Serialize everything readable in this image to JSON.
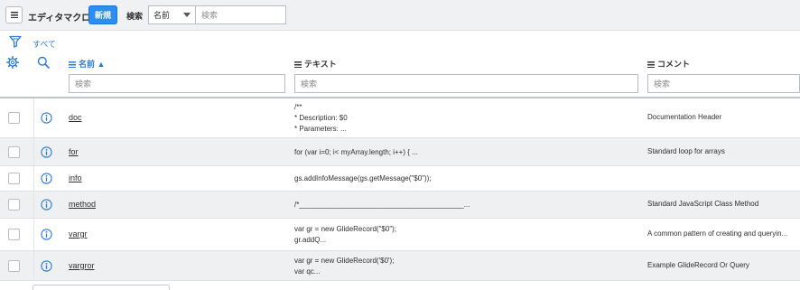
{
  "header": {
    "title": "エディタマクロ",
    "new_label": "新規",
    "search_label": "検索",
    "search_field": "名前",
    "search_placeholder": "検索"
  },
  "filter": {
    "label": "すべて"
  },
  "columns": [
    {
      "label": "名前 ▲",
      "sorted": true
    },
    {
      "label": "テキスト",
      "sorted": false
    },
    {
      "label": "コメント",
      "sorted": false
    }
  ],
  "column_filter_placeholder": "検索",
  "rows": [
    {
      "name": "doc",
      "text": "/**\n* Description: $0\n* Parameters: ...",
      "comment": "Documentation Header"
    },
    {
      "name": "for",
      "text": "for (var i=0; i< myArray.length; i++) { ...",
      "comment": "Standard loop for arrays"
    },
    {
      "name": "info",
      "text": "gs.addInfoMessage(gs.getMessage(\"$0\"));",
      "comment": ""
    },
    {
      "name": "method",
      "text": "/*_________________________________________...",
      "comment": "Standard JavaScript Class Method"
    },
    {
      "name": "vargr",
      "text": "var gr = new GlideRecord(\"$0\");\ngr.addQ...",
      "comment": "A common pattern of creating and queryin..."
    },
    {
      "name": "vargror",
      "text": "var gr = new GlideRecord('$0');\nvar qc...",
      "comment": "Example GlideRecord Or Query"
    }
  ],
  "colors": {
    "accent": "#2c8ef0",
    "link": "#2c7bd6",
    "row_alt": "#eef0f1"
  }
}
